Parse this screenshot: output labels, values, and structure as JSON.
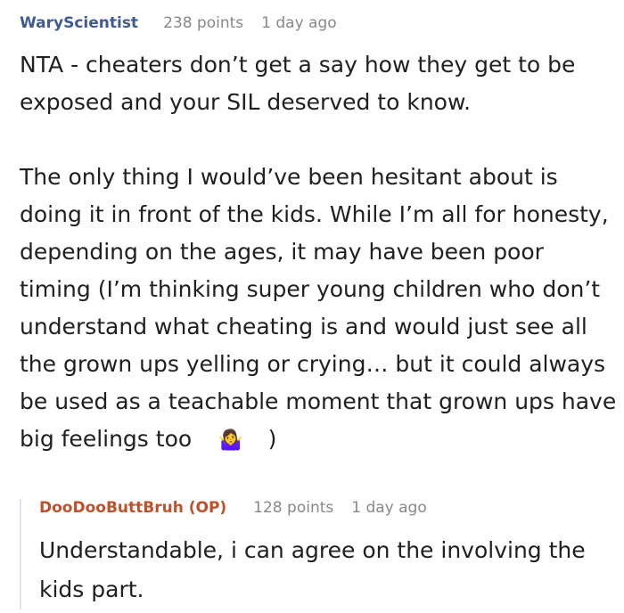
{
  "comment": {
    "username": "WaryScientist",
    "points": "238 points",
    "time": "1 day ago",
    "paragraph1": "NTA - cheaters don’t get a say how they get to be exposed and your SIL deserved to know.",
    "paragraph2": "The only thing I would’ve been hesitant about is doing it in front of the kids. While I’m all for honesty, depending on the ages, it may have been poor timing (I’m thinking super young children who don’t understand what cheating is and would just see all the grown ups yelling or crying… but it could always be used as a teachable moment that grown ups have big feelings too",
    "emoji": "🤷‍♀️",
    "emoji_icon": "woman-shrugging-icon",
    "paragraph2_end": ")"
  },
  "reply": {
    "username": "DooDooButtBruh (OP)",
    "points": "128 points",
    "time": "1 day ago",
    "text": "Understandable, i can agree on the involving the kids part."
  },
  "colors": {
    "username": "#3f5b94",
    "op_username": "#c0502b",
    "meta": "#888888",
    "text": "#202020",
    "thread_line": "#e4e4e4"
  }
}
